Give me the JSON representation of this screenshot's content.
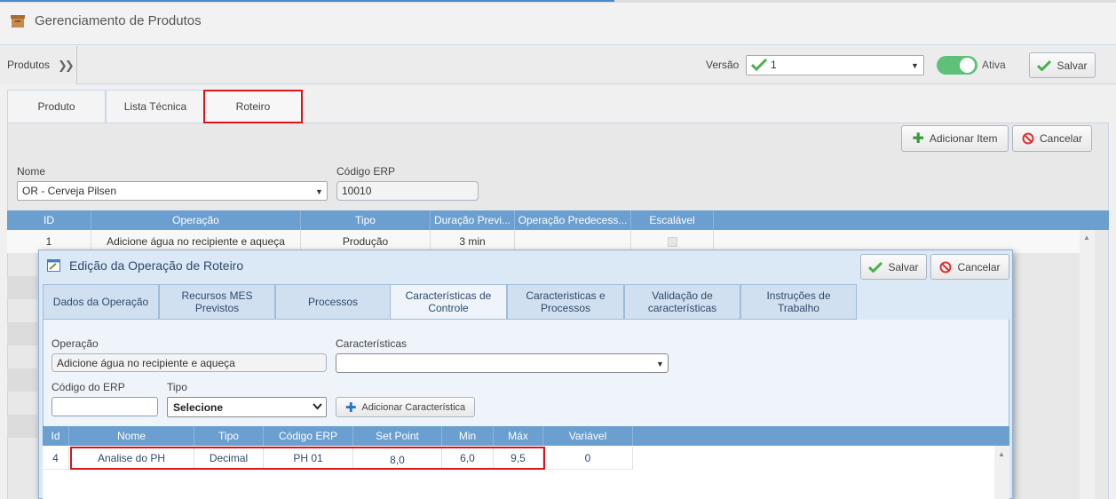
{
  "app": {
    "title": "Gerenciamento de Produtos"
  },
  "breadcrumb": {
    "label": "Produtos"
  },
  "version": {
    "label": "Versão",
    "value": "1",
    "active_label": "Ativa",
    "save_label": "Salvar"
  },
  "tabs": [
    {
      "label": "Produto"
    },
    {
      "label": "Lista Técnica"
    },
    {
      "label": "Roteiro"
    }
  ],
  "actions": {
    "add_item": "Adicionar Item",
    "cancel": "Cancelar"
  },
  "form": {
    "name_label": "Nome",
    "name_value": "OR - Cerveja Pilsen",
    "erp_label": "Código ERP",
    "erp_value": "10010"
  },
  "operations_grid": {
    "columns": [
      "ID",
      "Operação",
      "Tipo",
      "Duração Previ...",
      "Operação Predecess...",
      "Escalável"
    ],
    "rows": [
      {
        "id": "1",
        "operacao": "Adicione água no recipiente e aqueça",
        "tipo": "Produção",
        "duracao": "3 min",
        "predecessora": "",
        "escalavel": ""
      }
    ]
  },
  "modal": {
    "title": "Edição da Operação de Roteiro",
    "save_label": "Salvar",
    "cancel_label": "Cancelar",
    "tabs": [
      {
        "label": "Dados da Operação"
      },
      {
        "label": "Recursos MES Previstos"
      },
      {
        "label": "Processos"
      },
      {
        "label": "Características de Controle"
      },
      {
        "label": "Caracteristicas e Processos"
      },
      {
        "label": "Validação de características"
      },
      {
        "label": "Instruções de Trabalho"
      }
    ],
    "form": {
      "operacao_label": "Operação",
      "operacao_value": "Adicione água no recipiente e aqueça",
      "caracteristicas_label": "Características",
      "caracteristicas_value": "",
      "codigo_erp_label": "Código do ERP",
      "codigo_erp_value": "",
      "tipo_label": "Tipo",
      "tipo_value": "Selecione",
      "add_char_label": "Adicionar Característica"
    },
    "grid": {
      "columns": [
        "Id",
        "Nome",
        "Tipo",
        "Código ERP",
        "Set Point",
        "Min",
        "Máx",
        "Variável"
      ],
      "rows": [
        {
          "id": "4",
          "nome": "Analise do PH",
          "tipo": "Decimal",
          "codigo_erp": "PH 01",
          "set_point": "8,0",
          "min": "6,0",
          "max": "9,5",
          "variavel": "0"
        }
      ]
    }
  },
  "colors": {
    "header_blue": "#6a9fd0",
    "highlight_red": "#d9141b",
    "toggle_green": "#5fc07a"
  }
}
